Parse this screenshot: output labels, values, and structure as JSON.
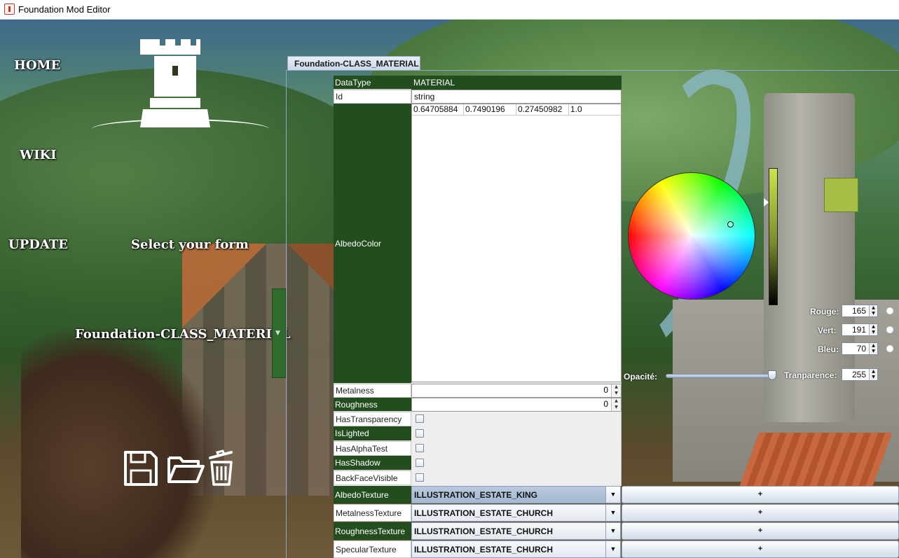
{
  "window": {
    "title": "Foundation Mod Editor"
  },
  "nav": {
    "home": "HOME",
    "wiki": "WIKI",
    "update": "UPDATE"
  },
  "form_select": {
    "label": "Select your form",
    "current": "Foundation-CLASS_MATERIAL"
  },
  "tab": {
    "label": "Foundation-CLASS_MATERIAL"
  },
  "properties": {
    "datatype": {
      "label": "DataType",
      "value": "MATERIAL"
    },
    "id": {
      "label": "Id",
      "value": "string"
    },
    "albedo": {
      "label": "AlbedoColor",
      "values": [
        "0.64705884",
        "0.7490196",
        "0.27450982",
        "1.0"
      ]
    },
    "metalness": {
      "label": "Metalness",
      "value": "0"
    },
    "roughness": {
      "label": "Roughness",
      "value": "0"
    },
    "has_transparency": {
      "label": "HasTransparency",
      "checked": false
    },
    "is_lighted": {
      "label": "IsLighted",
      "checked": false
    },
    "has_alpha_test": {
      "label": "HasAlphaTest",
      "checked": false
    },
    "has_shadow": {
      "label": "HasShadow",
      "checked": false
    },
    "backface_visible": {
      "label": "BackFaceVisible",
      "checked": false
    }
  },
  "textures": [
    {
      "label": "AlbedoTexture",
      "value": "ILLUSTRATION_ESTATE_KING",
      "add": "+"
    },
    {
      "label": "MetalnessTexture",
      "value": "ILLUSTRATION_ESTATE_CHURCH",
      "add": "+"
    },
    {
      "label": "RoughnessTexture",
      "value": "ILLUSTRATION_ESTATE_CHURCH",
      "add": "+"
    },
    {
      "label": "SpecularTexture",
      "value": "ILLUSTRATION_ESTATE_CHURCH",
      "add": "+"
    }
  ],
  "color_chooser": {
    "rouge_label": "Rouge:",
    "rouge": "165",
    "vert_label": "Vert:",
    "vert": "191",
    "bleu_label": "Bleu:",
    "bleu": "70",
    "opacity_label": "Opacité:",
    "transparence_label": "Tranparence:",
    "transparence": "255",
    "swatch_color": "#a5bf46"
  },
  "icons": {
    "app": "java-cup-icon",
    "logo": "rook-icon",
    "save": "floppy-disk-icon",
    "open": "folder-open-icon",
    "delete": "trash-icon"
  }
}
